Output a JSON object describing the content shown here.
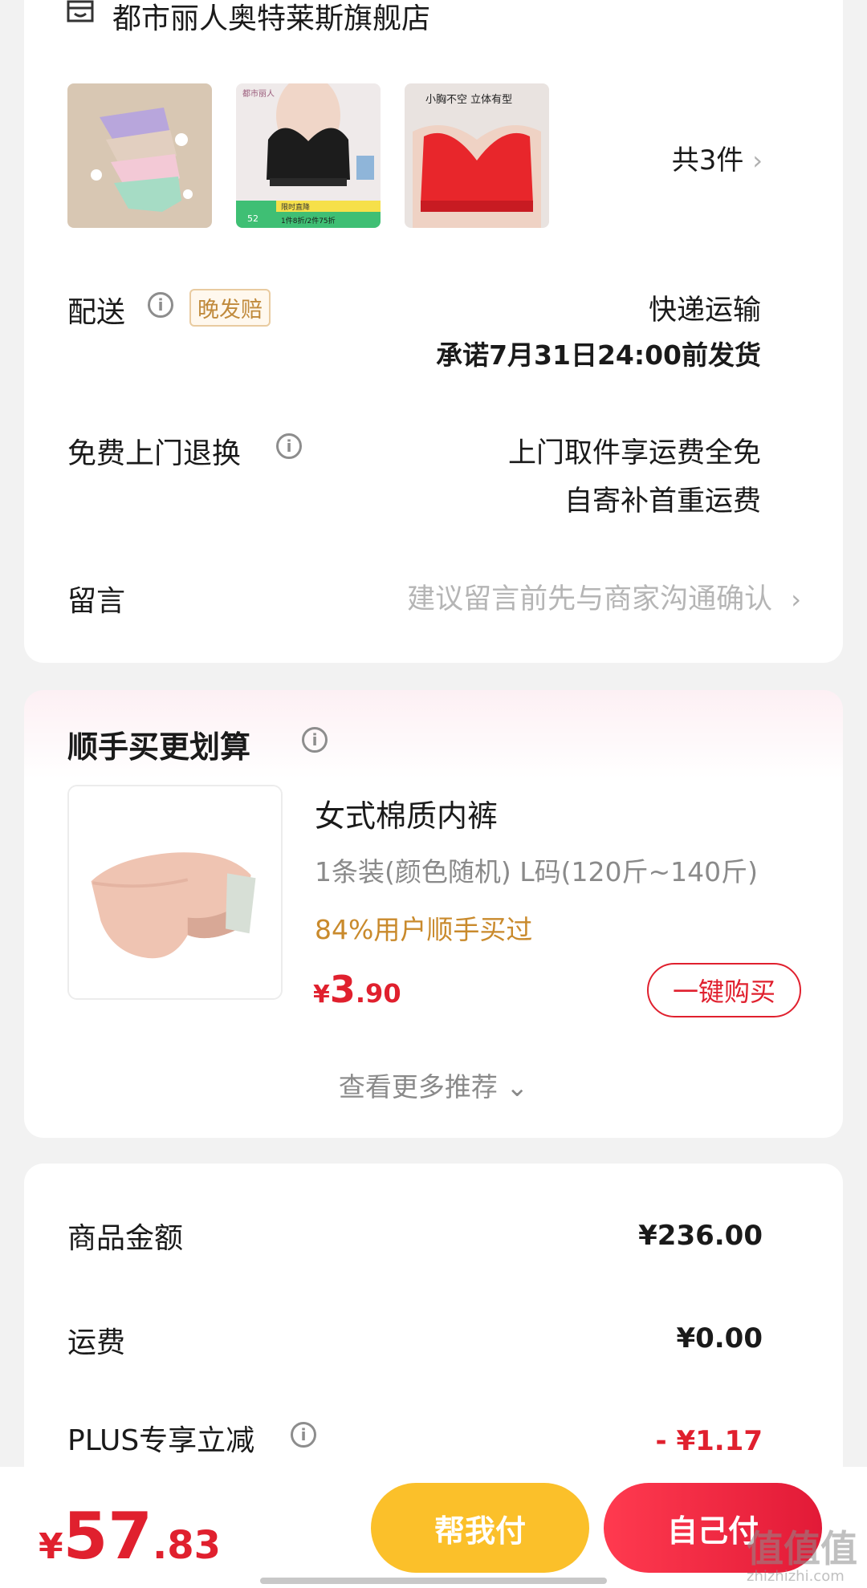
{
  "store": {
    "name": "都市丽人奥特莱斯旗舰店",
    "count_label": "共3件",
    "count_chevron": "›"
  },
  "products": [
    {
      "name": "panties-pastel-pack-image"
    },
    {
      "name": "black-lace-bra-image",
      "brand_text": "都市丽人",
      "promo_text": "限时直降",
      "promo_text2": "1件8折/2件75折",
      "promo_num": "52"
    },
    {
      "name": "red-bra-image",
      "caption": "小胸不空 立体有型"
    }
  ],
  "delivery": {
    "label": "配送",
    "badge": "晚发赔",
    "method": "快递运输",
    "promise": "承诺7月31日24:00前发货"
  },
  "returns": {
    "label": "免费上门退换",
    "line1": "上门取件享运费全免",
    "line2": "自寄补首重运费"
  },
  "message": {
    "label": "留言",
    "placeholder": "建议留言前先与商家沟通确认",
    "chevron": "›"
  },
  "addon": {
    "title": "顺手买更划算",
    "product_name": "女式棉质内裤",
    "spec": "1条装(颜色随机)   L码(120斤~140斤)",
    "social": "84%用户顺手买过",
    "price_symbol": "¥",
    "price_int": "3",
    "price_dec": ".90",
    "buy_label": "一键购买",
    "more_label": "查看更多推荐",
    "more_chevron": "⌄"
  },
  "cost": {
    "goods_label": "商品金额",
    "goods_value": "¥236.00",
    "shipping_label": "运费",
    "shipping_value": "¥0.00",
    "plus_label": "PLUS专享立减",
    "plus_value": "- ¥1.17"
  },
  "bottom": {
    "total_symbol": "¥",
    "total_int": "57",
    "total_dec": ".83",
    "help_pay_label": "帮我付",
    "self_pay_label": "自己付",
    "watermark": "值值值",
    "watermark_sub": "zhizhizhi.com"
  },
  "colors": {
    "accent_red": "#e0202e",
    "help_pay_yellow": "#fbc02a",
    "social_orange": "#c98a2c"
  }
}
